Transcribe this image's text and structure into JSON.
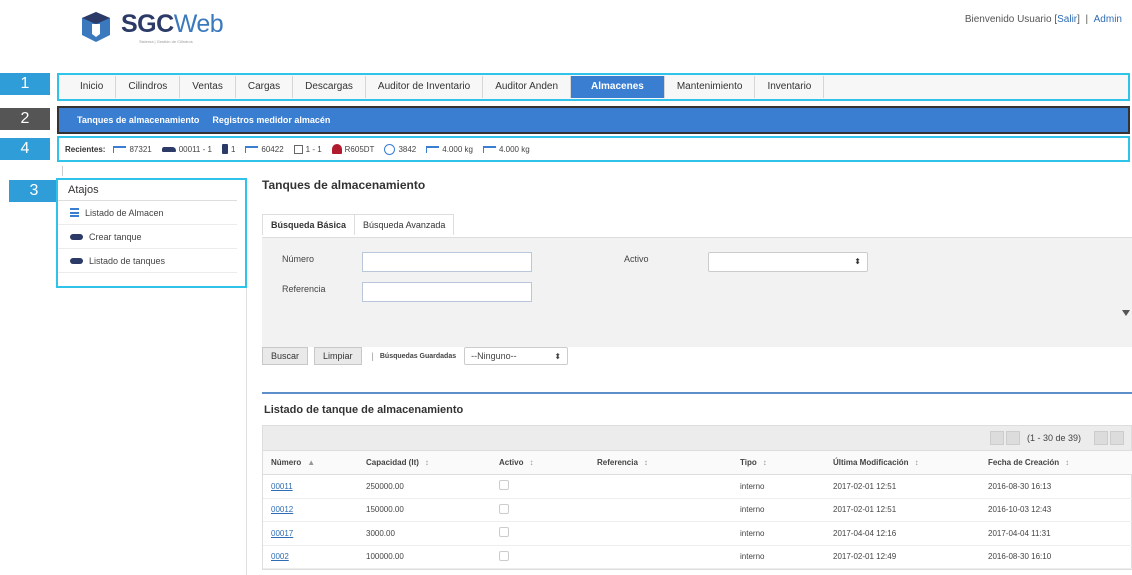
{
  "brand": {
    "name_bold": "SGC",
    "name_light": "Web",
    "tagline": "Sistema | Gestión de Cilindros"
  },
  "header": {
    "welcome_prefix": "Bienvenido Usuario [",
    "exit": "Salir",
    "welcome_suffix": "]",
    "divider": "|",
    "admin": "Admin"
  },
  "callouts": [
    "1",
    "2",
    "3",
    "4"
  ],
  "menu": [
    {
      "label": "Inicio"
    },
    {
      "label": "Cilindros"
    },
    {
      "label": "Ventas"
    },
    {
      "label": "Cargas"
    },
    {
      "label": "Descargas"
    },
    {
      "label": "Auditor de Inventario"
    },
    {
      "label": "Auditor Anden"
    },
    {
      "label": "Almacenes",
      "active": true
    },
    {
      "label": "Mantenimiento"
    },
    {
      "label": "Inventario"
    }
  ],
  "submenu": [
    "Tanques de almacenamiento",
    "Registros medidor almacén"
  ],
  "recent": {
    "label": "Recientes:",
    "items": [
      {
        "icon": "truck-icon",
        "text": "87321"
      },
      {
        "icon": "car-icon",
        "text": "00011 - 1"
      },
      {
        "icon": "tank-icon",
        "text": "1"
      },
      {
        "icon": "truck-icon",
        "text": "60422"
      },
      {
        "icon": "box-icon",
        "text": "1 - 1"
      },
      {
        "icon": "cylinder-icon",
        "text": "R605DT"
      },
      {
        "icon": "clock-icon",
        "text": "3842"
      },
      {
        "icon": "truck-icon",
        "text": "4.000 kg"
      },
      {
        "icon": "truck-icon",
        "text": "4.000 kg"
      }
    ]
  },
  "sidebar": {
    "title": "Atajos",
    "items": [
      {
        "icon": "list-icon",
        "label": "Listado de Almacen"
      },
      {
        "icon": "car-icon",
        "label": "Crear tanque"
      },
      {
        "icon": "car-icon",
        "label": "Listado de tanques"
      }
    ]
  },
  "main": {
    "title": "Tanques de almacenamiento",
    "search_tabs": [
      "Búsqueda Básica",
      "Búsqueda Avanzada"
    ],
    "fields": {
      "numero": "Número",
      "referencia": "Referencia",
      "activo": "Activo"
    },
    "buttons": {
      "search": "Buscar",
      "clear": "Limpiar",
      "separator": "|"
    },
    "saved_searches": {
      "label": "Búsquedas Guardadas",
      "value": "--Ninguno--"
    },
    "list_title": "Listado de tanque de almacenamiento",
    "pager": "(1 - 30 de 39)",
    "columns": [
      "Número",
      "Capacidad (lt)",
      "Activo",
      "Referencia",
      "Tipo",
      "Última Modificación",
      "Fecha de Creación"
    ],
    "sort_marks": [
      "▲",
      "↕",
      "↕",
      "↕",
      "↕",
      "↕",
      "↕"
    ],
    "rows": [
      {
        "numero": "00011",
        "capacidad": "250000.00",
        "referencia": "",
        "tipo": "interno",
        "modificacion": "2017-02-01 12:51",
        "creacion": "2016-08-30 16:13"
      },
      {
        "numero": "00012",
        "capacidad": "150000.00",
        "referencia": "",
        "tipo": "interno",
        "modificacion": "2017-02-01 12:51",
        "creacion": "2016-10-03 12:43"
      },
      {
        "numero": "00017",
        "capacidad": "3000.00",
        "referencia": "",
        "tipo": "interno",
        "modificacion": "2017-04-04 12:16",
        "creacion": "2017-04-04 11:31"
      },
      {
        "numero": "0002",
        "capacidad": "100000.00",
        "referencia": "",
        "tipo": "interno",
        "modificacion": "2017-02-01 12:49",
        "creacion": "2016-08-30 16:10"
      }
    ]
  },
  "colors": {
    "accent": "#3a7ed1",
    "callout": "#2f9ed8",
    "callout_dark": "#555555",
    "highlight_border": "#2fc3ea",
    "brand_dark": "#2b3a67"
  }
}
